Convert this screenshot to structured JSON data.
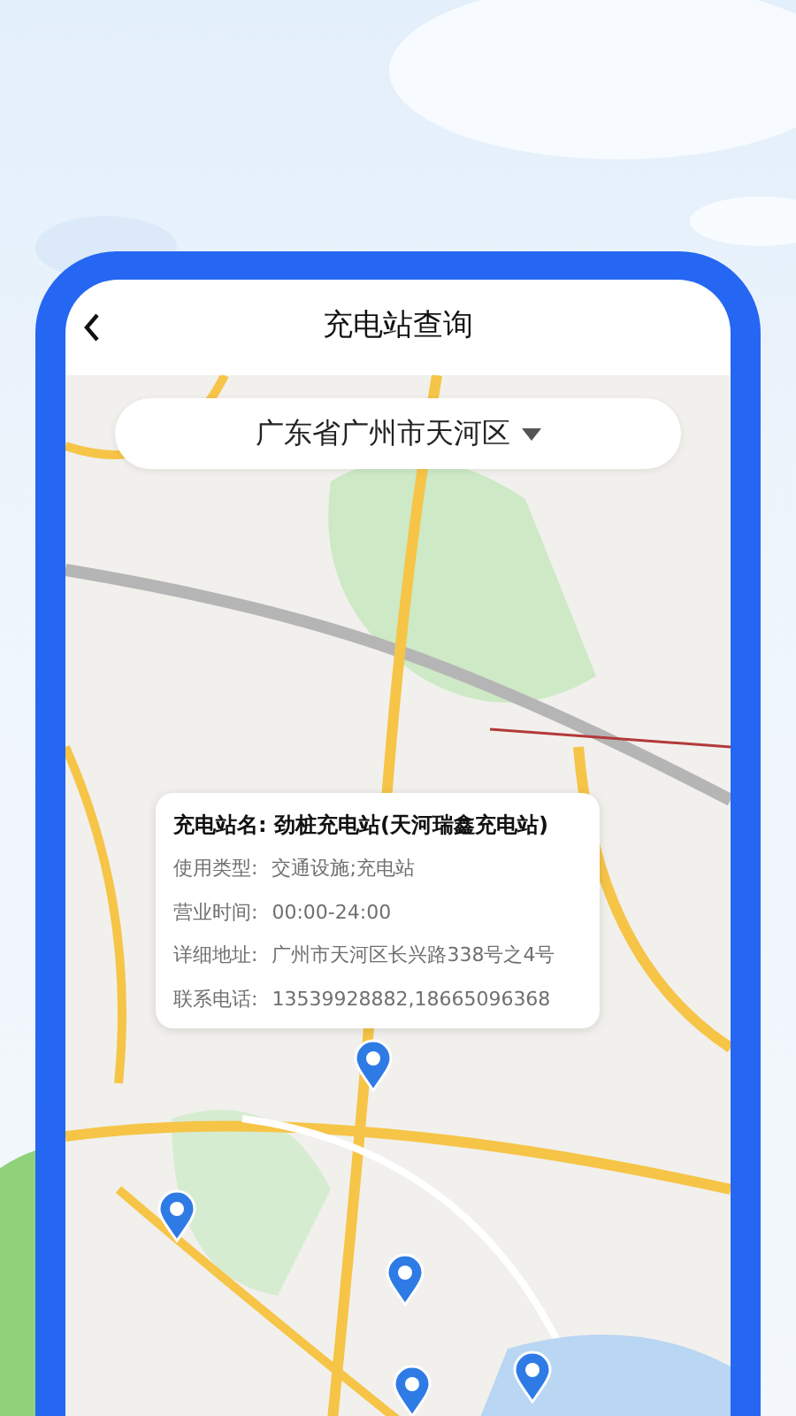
{
  "header": {
    "title": "充电站查询"
  },
  "region_selector": {
    "value": "广东省广州市天河区"
  },
  "station_card": {
    "title": "充电站名: 劲桩充电站(天河瑞鑫充电站)",
    "rows": [
      {
        "label": "使用类型:",
        "value": "交通设施;充电站"
      },
      {
        "label": "营业时间:",
        "value": "00:00-24:00"
      },
      {
        "label": "详细地址:",
        "value": "广州市天河区长兴路338号之4号"
      },
      {
        "label": "联系电话:",
        "value": "13539928882,18665096368"
      }
    ]
  }
}
